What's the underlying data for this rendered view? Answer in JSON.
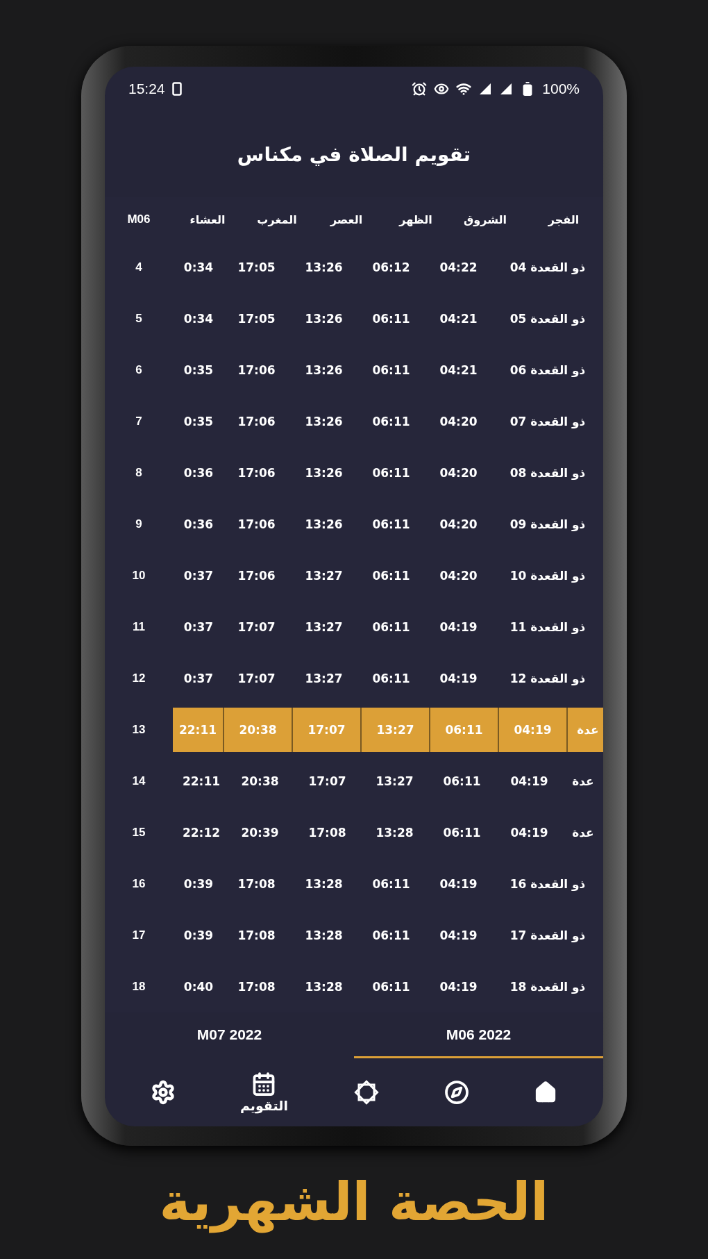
{
  "status_bar": {
    "time": "15:24",
    "battery": "100%"
  },
  "title": "تقويم الصلاة في مكناس",
  "table": {
    "day_column": "M06",
    "columns": [
      "العشاء",
      "المغرب",
      "العصر",
      "الظهر",
      "الشروق",
      "الفجر"
    ],
    "rows": [
      {
        "day": "4",
        "kind": "normal",
        "selected": false,
        "cells": [
          "0:34",
          "17:05",
          "13:26",
          "06:12",
          "04:22",
          "04 ذو القعدة"
        ]
      },
      {
        "day": "5",
        "kind": "normal",
        "selected": false,
        "cells": [
          "0:34",
          "17:05",
          "13:26",
          "06:11",
          "04:21",
          "05 ذو القعدة"
        ]
      },
      {
        "day": "6",
        "kind": "normal",
        "selected": false,
        "cells": [
          "0:35",
          "17:06",
          "13:26",
          "06:11",
          "04:21",
          "06 ذو القعدة"
        ]
      },
      {
        "day": "7",
        "kind": "normal",
        "selected": false,
        "cells": [
          "0:35",
          "17:06",
          "13:26",
          "06:11",
          "04:20",
          "07 ذو القعدة"
        ]
      },
      {
        "day": "8",
        "kind": "normal",
        "selected": false,
        "cells": [
          "0:36",
          "17:06",
          "13:26",
          "06:11",
          "04:20",
          "08 ذو القعدة"
        ]
      },
      {
        "day": "9",
        "kind": "normal",
        "selected": false,
        "cells": [
          "0:36",
          "17:06",
          "13:26",
          "06:11",
          "04:20",
          "09 ذو القعدة"
        ]
      },
      {
        "day": "10",
        "kind": "normal",
        "selected": false,
        "cells": [
          "0:37",
          "17:06",
          "13:27",
          "06:11",
          "04:20",
          "10 ذو القعدة"
        ]
      },
      {
        "day": "11",
        "kind": "normal",
        "selected": false,
        "cells": [
          "0:37",
          "17:07",
          "13:27",
          "06:11",
          "04:19",
          "11 ذو القعدة"
        ]
      },
      {
        "day": "12",
        "kind": "normal",
        "selected": false,
        "cells": [
          "0:37",
          "17:07",
          "13:27",
          "06:11",
          "04:19",
          "12 ذو القعدة"
        ]
      },
      {
        "day": "13",
        "kind": "scrolled",
        "selected": true,
        "cells": [
          "22:11",
          "20:38",
          "17:07",
          "13:27",
          "06:11",
          "04:19",
          "عدة"
        ]
      },
      {
        "day": "14",
        "kind": "scrolled",
        "selected": false,
        "cells": [
          "22:11",
          "20:38",
          "17:07",
          "13:27",
          "06:11",
          "04:19",
          "عدة"
        ]
      },
      {
        "day": "15",
        "kind": "scrolled",
        "selected": false,
        "cells": [
          "22:12",
          "20:39",
          "17:08",
          "13:28",
          "06:11",
          "04:19",
          "عدة"
        ]
      },
      {
        "day": "16",
        "kind": "normal",
        "selected": false,
        "cells": [
          "0:39",
          "17:08",
          "13:28",
          "06:11",
          "04:19",
          "16 ذو القعدة"
        ]
      },
      {
        "day": "17",
        "kind": "normal",
        "selected": false,
        "cells": [
          "0:39",
          "17:08",
          "13:28",
          "06:11",
          "04:19",
          "17 ذو القعدة"
        ]
      },
      {
        "day": "18",
        "kind": "normal",
        "selected": false,
        "cells": [
          "0:40",
          "17:08",
          "13:28",
          "06:11",
          "04:19",
          "18 ذو القعدة"
        ]
      }
    ]
  },
  "month_tabs": [
    {
      "label": "M07 2022",
      "selected": false
    },
    {
      "label": "M06 2022",
      "selected": true
    }
  ],
  "nav": [
    {
      "kind": "settings"
    },
    {
      "kind": "calendar",
      "label": "التقويم"
    },
    {
      "kind": "star"
    },
    {
      "kind": "compass"
    },
    {
      "kind": "home"
    }
  ],
  "caption": "الحصة الشهرية"
}
